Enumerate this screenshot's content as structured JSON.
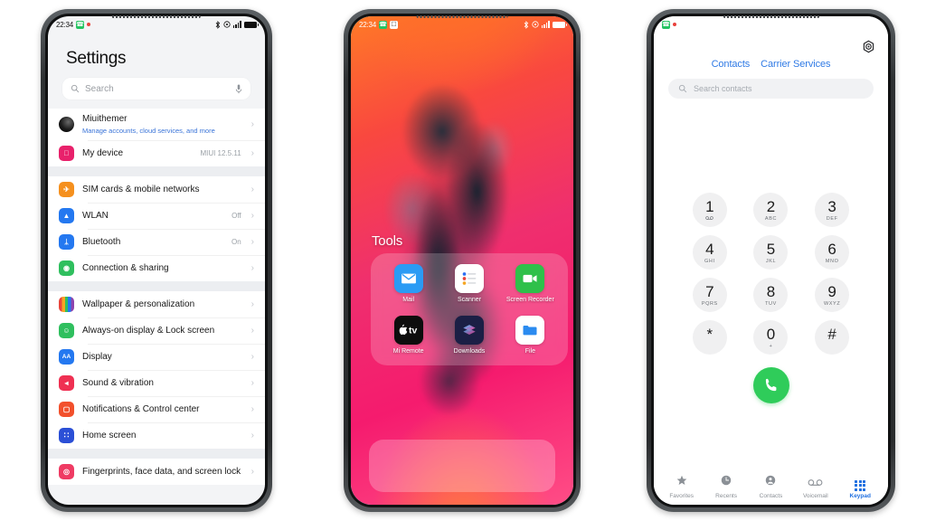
{
  "phone1": {
    "name": "settings-phone",
    "statusbar": {
      "time": "22:34",
      "phone_icon": "phone-green-icon",
      "notification_dot": "red-dot",
      "bluetooth": "bluetooth-icon",
      "alarm": "alarm-icon",
      "signal": "signal-bars-icon",
      "battery": "battery-icon"
    },
    "title": "Settings",
    "search": {
      "placeholder": "Search",
      "icon": "search-icon",
      "mic_icon": "microphone-icon"
    },
    "groups": [
      {
        "items": [
          {
            "label": "Miuithemer",
            "sub": "Manage accounts, cloud services, and more",
            "value": "",
            "icon": "account-avatar",
            "color": "#1a1a1a"
          },
          {
            "label": "My device",
            "sub": "",
            "value": "MIUI 12.5.11",
            "icon": "apple-icon",
            "color": "#e8216b"
          }
        ]
      },
      {
        "items": [
          {
            "label": "SIM cards & mobile networks",
            "sub": "",
            "value": "",
            "icon": "airplane-icon",
            "color": "#f5901e"
          },
          {
            "label": "WLAN",
            "sub": "",
            "value": "Off",
            "icon": "wifi-icon",
            "color": "#2478f0"
          },
          {
            "label": "Bluetooth",
            "sub": "",
            "value": "On",
            "icon": "bluetooth-icon",
            "color": "#2478f0"
          },
          {
            "label": "Connection & sharing",
            "sub": "",
            "value": "",
            "icon": "hotspot-icon",
            "color": "#2fbf5e"
          }
        ]
      },
      {
        "items": [
          {
            "label": "Wallpaper & personalization",
            "sub": "",
            "value": "",
            "icon": "wallpaper-icon",
            "color": "#8e44ad"
          },
          {
            "label": "Always-on display & Lock screen",
            "sub": "",
            "value": "",
            "icon": "face-icon",
            "color": "#2fbf5e"
          },
          {
            "label": "Display",
            "sub": "",
            "value": "",
            "icon": "display-aa-icon",
            "color": "#2478f0"
          },
          {
            "label": "Sound & vibration",
            "sub": "",
            "value": "",
            "icon": "speaker-icon",
            "color": "#ef3052"
          },
          {
            "label": "Notifications & Control center",
            "sub": "",
            "value": "",
            "icon": "notifications-icon",
            "color": "#f2502c"
          },
          {
            "label": "Home screen",
            "sub": "",
            "value": "",
            "icon": "home-screen-icon",
            "color": "#2b4fd6"
          }
        ]
      },
      {
        "items": [
          {
            "label": "Fingerprints, face data, and screen lock",
            "sub": "",
            "value": "",
            "icon": "fingerprint-icon",
            "color": "#ef3b63"
          }
        ]
      }
    ],
    "chevron": "›"
  },
  "phone2": {
    "name": "home-screen-phone",
    "statusbar": {
      "time": "22:34",
      "phone_icon": "phone-green-icon",
      "app_icon": "app-white-icon",
      "bluetooth": "bluetooth-icon",
      "alarm": "alarm-icon",
      "signal": "signal-bars-icon",
      "battery": "battery-icon"
    },
    "folder_title": "Tools",
    "apps": [
      {
        "label": "Mail",
        "icon": "mail-icon",
        "color": "#2b9bf4"
      },
      {
        "label": "Scanner",
        "icon": "scanner-icon",
        "color": "#ffffff"
      },
      {
        "label": "Screen Recorder",
        "icon": "screen-recorder-icon",
        "color": "#2fc04a"
      },
      {
        "label": "Mi Remote",
        "icon": "apple-tv-icon",
        "color": "#0d0d0d"
      },
      {
        "label": "Downloads",
        "icon": "downloads-icon",
        "color": "#1b1f45"
      },
      {
        "label": "File",
        "icon": "file-folder-icon",
        "color": "#ffffff"
      }
    ]
  },
  "phone3": {
    "name": "dialer-phone",
    "statusbar": {
      "phone_icon": "phone-green-icon",
      "notification_dot": "red-dot"
    },
    "settings_icon": "gear-icon",
    "tabs": [
      {
        "label": "Contacts"
      },
      {
        "label": "Carrier Services"
      }
    ],
    "search": {
      "placeholder": "Search contacts",
      "icon": "search-icon"
    },
    "keys": [
      {
        "num": "1",
        "sub": ""
      },
      {
        "num": "2",
        "sub": "ABC"
      },
      {
        "num": "3",
        "sub": "DEF"
      },
      {
        "num": "4",
        "sub": "GHI"
      },
      {
        "num": "5",
        "sub": "JKL"
      },
      {
        "num": "6",
        "sub": "MNO"
      },
      {
        "num": "7",
        "sub": "PQRS"
      },
      {
        "num": "8",
        "sub": "TUV"
      },
      {
        "num": "9",
        "sub": "WXYZ"
      },
      {
        "num": "*",
        "sub": ""
      },
      {
        "num": "0",
        "sub": "+"
      },
      {
        "num": "#",
        "sub": ""
      }
    ],
    "call_button": {
      "icon": "call-icon",
      "color": "#2fcc5a"
    },
    "tabbar": [
      {
        "label": "Favorites",
        "icon": "star-icon",
        "active": false
      },
      {
        "label": "Recents",
        "icon": "clock-icon",
        "active": false
      },
      {
        "label": "Contacts",
        "icon": "person-icon",
        "active": false
      },
      {
        "label": "Voicemail",
        "icon": "voicemail-icon",
        "active": false
      },
      {
        "label": "Keypad",
        "icon": "keypad-icon",
        "active": true
      }
    ]
  }
}
